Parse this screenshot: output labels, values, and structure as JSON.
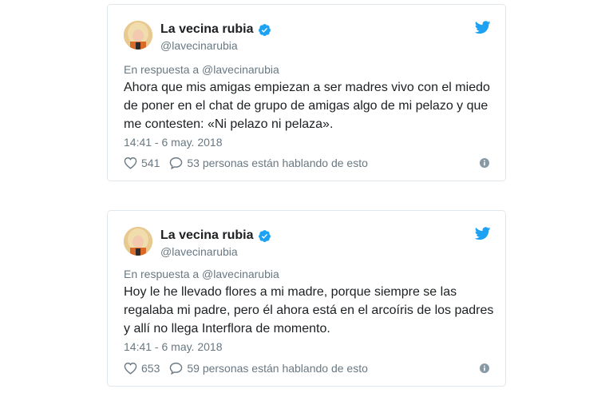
{
  "tweets": [
    {
      "author_name": "La vecina rubia",
      "author_handle": "@lavecinarubia",
      "reply_to": "En respuesta a @lavecinarubia",
      "text": "Ahora que mis amigas empiezan a ser madres vivo con el miedo  de poner en el chat de grupo de amigas algo de mi pelazo y que me  contesten: «Ni pelazo ni pelaza».",
      "timestamp": "14:41 - 6 may. 2018",
      "likes": "541",
      "conversation": "53 personas están hablando de esto"
    },
    {
      "author_name": "La vecina rubia",
      "author_handle": "@lavecinarubia",
      "reply_to": "En respuesta a @lavecinarubia",
      "text": "Hoy le he llevado flores a mi madre, porque siempre se las regalaba mi padre, pero él ahora está en el arcoíris de los padres y  allí no llega Interflora de momento.",
      "timestamp": "14:41 - 6 may. 2018",
      "likes": "653",
      "conversation": "59 personas están hablando de esto"
    }
  ],
  "icons": {
    "verified": "verified-badge-icon",
    "brand": "twitter-bird-icon",
    "like": "heart-icon",
    "reply": "speech-bubble-icon",
    "info": "info-icon"
  },
  "colors": {
    "twitter_blue": "#1da1f2",
    "secondary_text": "#697882",
    "border": "#e1e8ed"
  }
}
